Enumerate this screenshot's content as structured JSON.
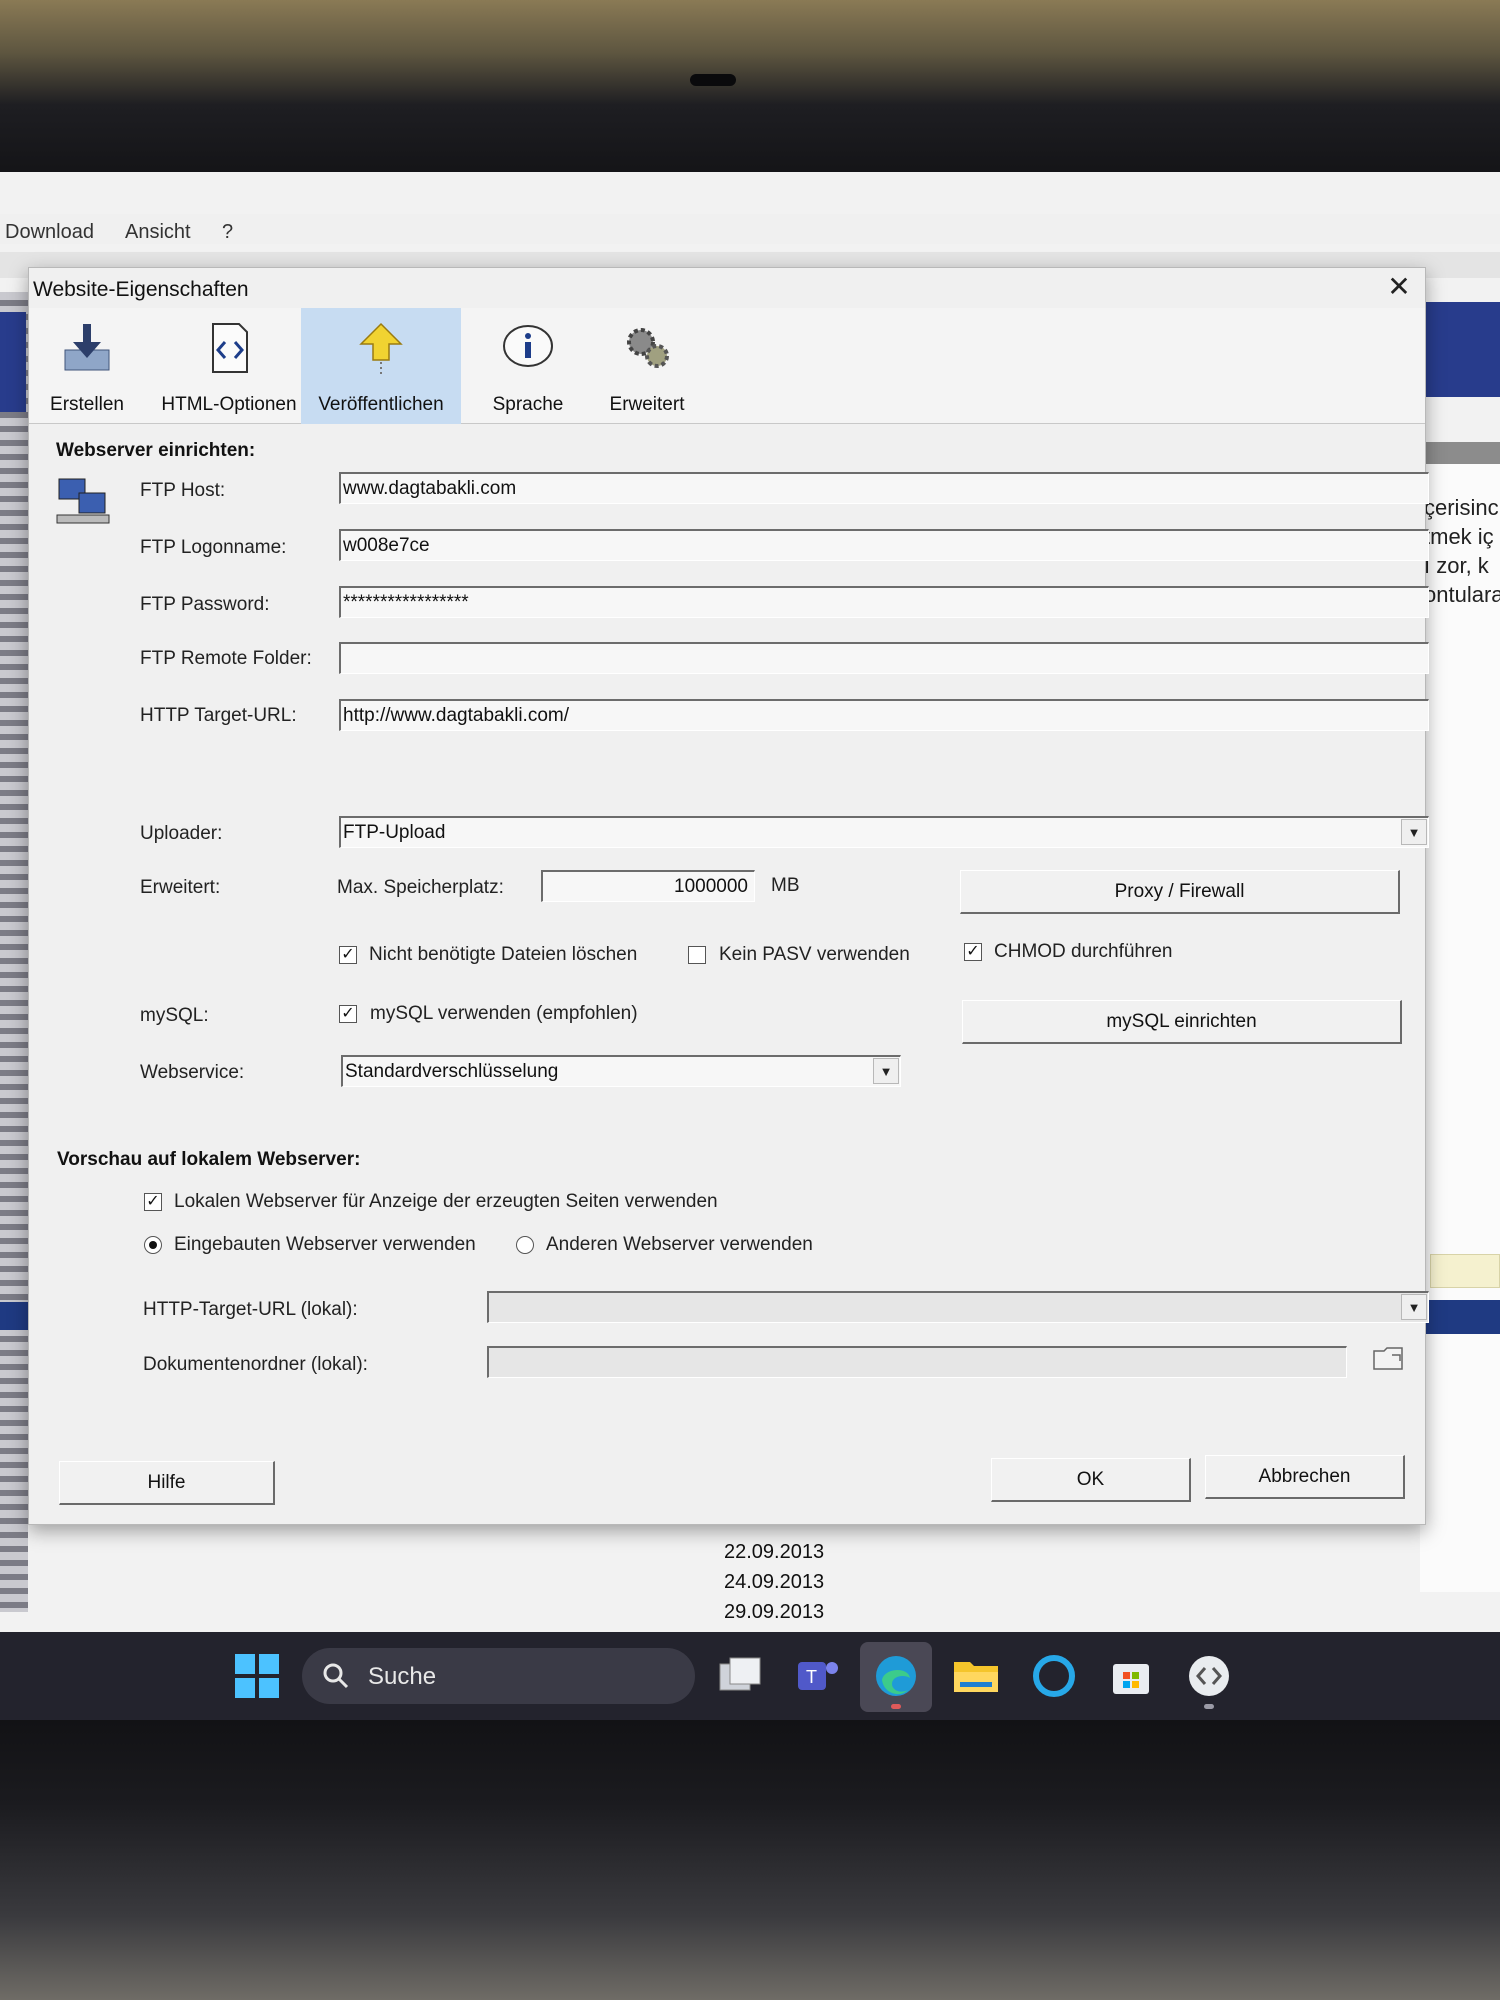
{
  "background_app": {
    "menu": [
      "Download",
      "Ansicht",
      "?"
    ],
    "right_text": [
      "çerisinc",
      "tmek iç",
      "ı zor, k",
      "ontulara"
    ],
    "dates": [
      "22.09.2013",
      "24.09.2013",
      "29.09.2013"
    ]
  },
  "dialog": {
    "title": "Website-Eigenschaften",
    "close_icon": "close-icon",
    "tabs": [
      {
        "label": "Erstellen",
        "icon": "download-icon",
        "active": false
      },
      {
        "label": "HTML-Optionen",
        "icon": "code-icon",
        "active": false
      },
      {
        "label": "Veröffentlichen",
        "icon": "upload-arrow-icon",
        "active": true
      },
      {
        "label": "Sprache",
        "icon": "info-icon",
        "active": false
      },
      {
        "label": "Erweitert",
        "icon": "gears-icon",
        "active": false
      }
    ],
    "webserver": {
      "heading": "Webserver einrichten:",
      "ftp_host_label": "FTP Host:",
      "ftp_host": "www.dagtabakli.com",
      "ftp_logon_label": "FTP Logonname:",
      "ftp_logon": "w008e7ce",
      "ftp_password_label": "FTP Password:",
      "ftp_password": "*****************",
      "ftp_remote_label": "FTP Remote Folder:",
      "ftp_remote": "",
      "http_target_label": "HTTP Target-URL:",
      "http_target": "http://www.dagtabakli.com/",
      "uploader_label": "Uploader:",
      "uploader": "FTP-Upload",
      "erweitert_label": "Erweitert:",
      "max_space_label": "Max. Speicherplatz:",
      "max_space": "1000000",
      "max_space_unit": "MB",
      "proxy_button": "Proxy / Firewall",
      "chk_delete": {
        "label": "Nicht benötigte Dateien löschen",
        "checked": true
      },
      "chk_pasv": {
        "label": "Kein PASV verwenden",
        "checked": false
      },
      "chk_chmod": {
        "label": "CHMOD durchführen",
        "checked": true
      },
      "mysql_label": "mySQL:",
      "chk_mysql": {
        "label": "mySQL verwenden (empfohlen)",
        "checked": true
      },
      "mysql_button": "mySQL einrichten",
      "webservice_label": "Webservice:",
      "webservice": "Standardverschlüsselung"
    },
    "preview": {
      "heading": "Vorschau auf lokalem Webserver:",
      "chk_local": {
        "label": "Lokalen Webserver für Anzeige der erzeugten Seiten verwenden",
        "checked": true
      },
      "radio_builtin": {
        "label": "Eingebauten Webserver verwenden",
        "selected": true
      },
      "radio_other": {
        "label": "Anderen Webserver verwenden",
        "selected": false
      },
      "http_local_label": "HTTP-Target-URL (lokal):",
      "http_local": "",
      "doc_folder_label": "Dokumentenordner (lokal):",
      "doc_folder": ""
    },
    "buttons": {
      "help": "Hilfe",
      "ok": "OK",
      "cancel": "Abbrechen"
    }
  },
  "taskbar": {
    "search_placeholder": "Suche",
    "icons": [
      "windows-start-icon",
      "task-view-icon",
      "teams-icon",
      "edge-icon",
      "file-explorer-icon",
      "cortana-icon",
      "store-icon",
      "web-editor-icon"
    ]
  }
}
